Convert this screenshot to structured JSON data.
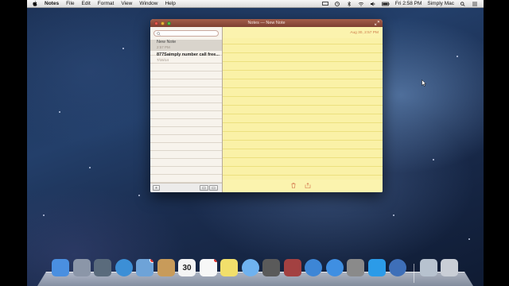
{
  "menubar": {
    "app_name": "Notes",
    "menus": [
      "File",
      "Edit",
      "Format",
      "View",
      "Window",
      "Help"
    ],
    "clock": "Fri 2:58 PM",
    "user": "Simply Mac",
    "status_icons": [
      "display-icon",
      "time-machine-icon",
      "bluetooth-icon",
      "wifi-icon",
      "volume-icon",
      "battery-icon",
      "search-icon",
      "list-icon"
    ]
  },
  "window": {
    "title": "Notes — New Note",
    "search": {
      "placeholder": ""
    },
    "notes": [
      {
        "title": "New Note",
        "date": "2:57 PM"
      },
      {
        "title": "877Saimply number call free...",
        "date": "7/15/14"
      }
    ],
    "note_date": "Aug 30, 2:57 PM",
    "note_body": ""
  },
  "dock": {
    "apps": [
      {
        "name": "finder-icon",
        "color": "#4a8fe0"
      },
      {
        "name": "launchpad-icon",
        "color": "#8b96a8"
      },
      {
        "name": "system-folder-icon",
        "color": "#5a6b7c"
      },
      {
        "name": "safari-icon",
        "color": "#3c8fd6"
      },
      {
        "name": "mail-icon",
        "color": "#6ea3d8",
        "badge": true
      },
      {
        "name": "contacts-icon",
        "color": "#c89b5a"
      },
      {
        "name": "calendar-icon",
        "color": "#f4f4f4"
      },
      {
        "name": "reminders-icon",
        "color": "#f7f7f7",
        "badge": true
      },
      {
        "name": "notes-icon",
        "color": "#f2df6b"
      },
      {
        "name": "messages-icon",
        "color": "#6fb2ef"
      },
      {
        "name": "facetime-icon",
        "color": "#5a5a5a"
      },
      {
        "name": "photo-booth-icon",
        "color": "#a34141"
      },
      {
        "name": "itunes-icon",
        "color": "#3d86d6"
      },
      {
        "name": "app-store-icon",
        "color": "#3f8fe2"
      },
      {
        "name": "system-preferences-icon",
        "color": "#8a8a8a"
      },
      {
        "name": "twitter-icon",
        "color": "#2b9be8"
      },
      {
        "name": "quicktime-icon",
        "color": "#3e6fb8"
      },
      {
        "name": "documents-folder-icon",
        "color": "#b7c2cf"
      },
      {
        "name": "trash-icon",
        "color": "#c9ced6"
      }
    ],
    "calendar_day": "30"
  },
  "colors": {
    "title_bar": "#8f4b3a",
    "note_paper": "#faf1a7",
    "note_date": "#cc7a49"
  }
}
